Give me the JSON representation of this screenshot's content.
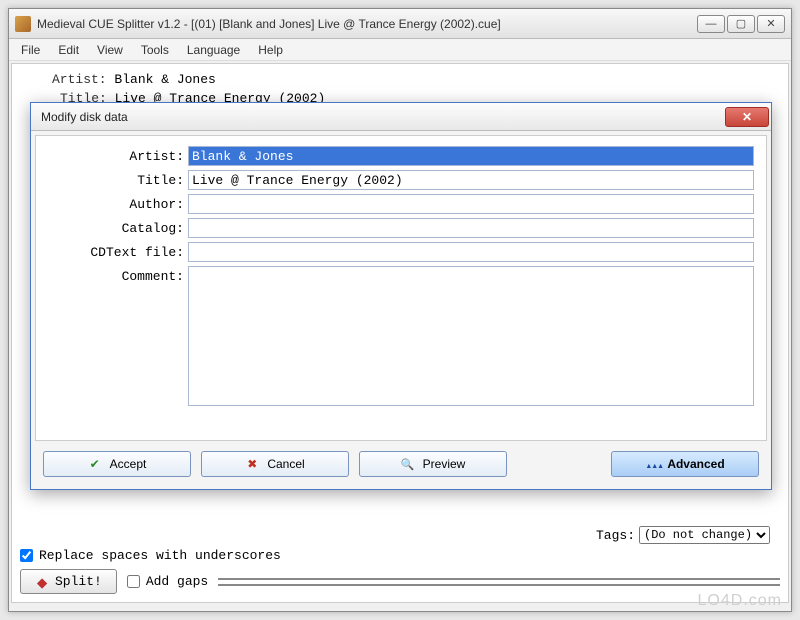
{
  "mainWindow": {
    "title": "Medieval CUE Splitter v1.2 - [(01) [Blank and Jones] Live @ Trance Energy (2002).cue]",
    "menu": {
      "file": "File",
      "edit": "Edit",
      "view": "View",
      "tools": "Tools",
      "language": "Language",
      "help": "Help"
    },
    "headerArtistLabel": "Artist:",
    "headerArtistValue": "Blank & Jones",
    "headerTitleLabel": "Title:",
    "headerTitleValue": "Live @ Trance Energy (2002)",
    "replaceSpaces": "Replace spaces with underscores",
    "addGaps": "Add gaps",
    "splitButton": "Split!",
    "tagsLabel": "Tags:",
    "tagsValue": "(Do not change)"
  },
  "dialog": {
    "title": "Modify disk data",
    "labels": {
      "artist": "Artist:",
      "title": "Title:",
      "author": "Author:",
      "catalog": "Catalog:",
      "cdtext": "CDText file:",
      "comment": "Comment:"
    },
    "values": {
      "artist": "Blank & Jones",
      "title": "Live @ Trance Energy (2002)",
      "author": "",
      "catalog": "",
      "cdtext": "",
      "comment": ""
    },
    "buttons": {
      "accept": "Accept",
      "cancel": "Cancel",
      "preview": "Preview",
      "advanced": "Advanced"
    }
  },
  "watermark": "LO4D.com"
}
